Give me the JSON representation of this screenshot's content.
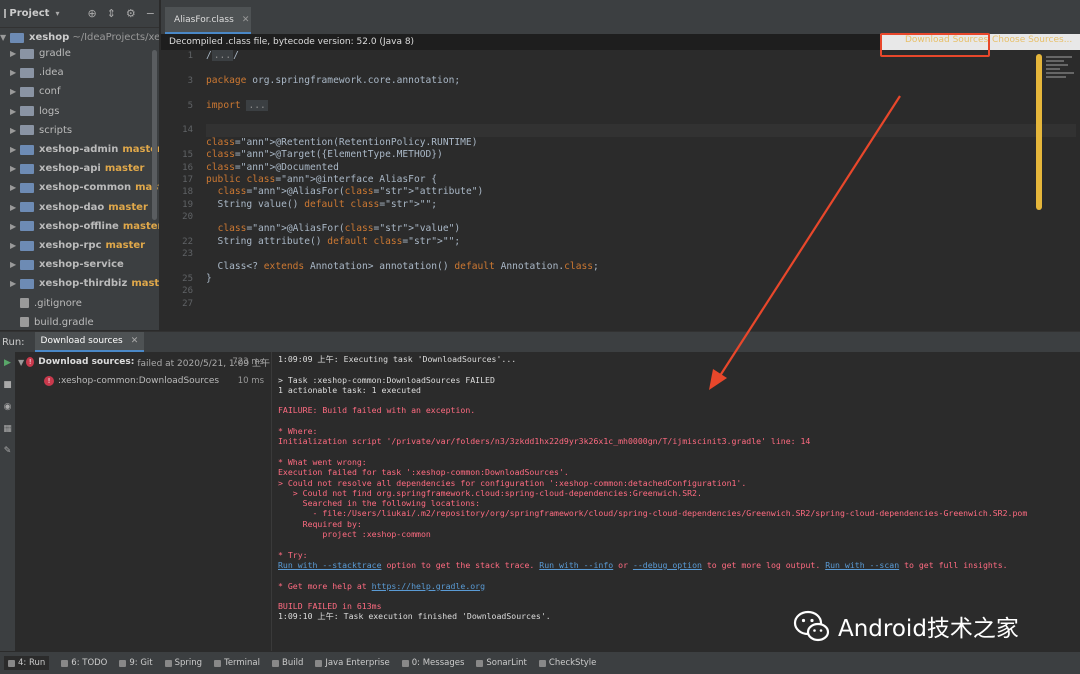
{
  "project": {
    "title": "Project",
    "root": "xeshop",
    "root_path": "~/IdeaProjects/xesho",
    "items": [
      {
        "label": "gradle",
        "branch": "",
        "type": "folder"
      },
      {
        "label": ".idea",
        "branch": "",
        "type": "folder"
      },
      {
        "label": "conf",
        "branch": "",
        "type": "folder"
      },
      {
        "label": "logs",
        "branch": "",
        "type": "folder"
      },
      {
        "label": "scripts",
        "branch": "",
        "type": "folder"
      },
      {
        "label": "xeshop-admin",
        "branch": "master",
        "type": "module"
      },
      {
        "label": "xeshop-api",
        "branch": "master",
        "type": "module"
      },
      {
        "label": "xeshop-common",
        "branch": "master",
        "type": "module"
      },
      {
        "label": "xeshop-dao",
        "branch": "master",
        "type": "module"
      },
      {
        "label": "xeshop-offline",
        "branch": "master",
        "type": "module"
      },
      {
        "label": "xeshop-rpc",
        "branch": "master",
        "type": "module"
      },
      {
        "label": "xeshop-service",
        "branch": "",
        "type": "module"
      },
      {
        "label": "xeshop-thirdbiz",
        "branch": "master",
        "type": "module"
      },
      {
        "label": ".gitignore",
        "branch": "",
        "type": "file"
      },
      {
        "label": "build.gradle",
        "branch": "",
        "type": "file"
      }
    ]
  },
  "editor": {
    "tab": "AliasFor.class",
    "notice": "Decompiled .class file, bytecode version: 52.0 (Java 8)",
    "download_sources": "Download Sources",
    "choose_sources": "Choose Sources...",
    "line_numbers": [
      "1",
      "",
      "3",
      "",
      "5",
      "",
      "14",
      "",
      "15",
      "16",
      "17",
      "18",
      "19",
      "20",
      "",
      "22",
      "23",
      "",
      "25",
      "26",
      "27"
    ],
    "code": [
      "/.../",
      "",
      "package org.springframework.core.annotation;",
      "",
      "import ...",
      "",
      "",
      "@Retention(RetentionPolicy.RUNTIME)",
      "@Target({ElementType.METHOD})",
      "@Documented",
      "public @interface AliasFor {",
      "  @AliasFor(\"attribute\")",
      "  String value() default \"\";",
      "",
      "  @AliasFor(\"value\")",
      "  String attribute() default \"\";",
      "",
      "  Class<? extends Annotation> annotation() default Annotation.class;",
      "}"
    ]
  },
  "run": {
    "label": "Run:",
    "tab": "Download sources",
    "tree": [
      {
        "label": "Download sources:",
        "detail": "failed at 2020/5/21, 1:09 上午",
        "duration": "723 ms"
      },
      {
        "label": ":xeshop-common:DownloadSources",
        "detail": "",
        "duration": "10 ms"
      }
    ],
    "console": [
      {
        "t": "1:09:09 上午: Executing task 'DownloadSources'...",
        "c": "normal"
      },
      {
        "t": "",
        "c": "blank"
      },
      {
        "t": "> Task :xeshop-common:DownloadSources FAILED",
        "c": "normal"
      },
      {
        "t": "1 actionable task: 1 executed",
        "c": "normal"
      },
      {
        "t": "",
        "c": "blank"
      },
      {
        "t": "FAILURE: Build failed with an exception.",
        "c": "red"
      },
      {
        "t": "",
        "c": "blank"
      },
      {
        "t": "* Where:",
        "c": "red"
      },
      {
        "t": "Initialization script '/private/var/folders/n3/3zkdd1hx22d9yr3k26x1c_mh0000gn/T/ijmiscinit3.gradle' line: 14",
        "c": "red"
      },
      {
        "t": "",
        "c": "blank"
      },
      {
        "t": "* What went wrong:",
        "c": "red"
      },
      {
        "t": "Execution failed for task ':xeshop-common:DownloadSources'.",
        "c": "red"
      },
      {
        "t": "> Could not resolve all dependencies for configuration ':xeshop-common:detachedConfiguration1'.",
        "c": "red"
      },
      {
        "t": "   > Could not find org.springframework.cloud:spring-cloud-dependencies:Greenwich.SR2.",
        "c": "red"
      },
      {
        "t": "     Searched in the following locations:",
        "c": "red"
      },
      {
        "t": "       - file:/Users/liukai/.m2/repository/org/springframework/cloud/spring-cloud-dependencies/Greenwich.SR2/spring-cloud-dependencies-Greenwich.SR2.pom",
        "c": "red"
      },
      {
        "t": "     Required by:",
        "c": "red"
      },
      {
        "t": "         project :xeshop-common",
        "c": "red"
      },
      {
        "t": "",
        "c": "blank"
      },
      {
        "t": "* Try:",
        "c": "red"
      },
      {
        "t": "",
        "c": "try"
      },
      {
        "t": "",
        "c": "blank"
      },
      {
        "t": "* Get more help at ",
        "c": "help"
      },
      {
        "t": "",
        "c": "blank"
      },
      {
        "t": "BUILD FAILED in 613ms",
        "c": "red"
      },
      {
        "t": "1:09:10 上午: Task execution finished 'DownloadSources'.",
        "c": "normal"
      }
    ],
    "try_parts": {
      "a": "Run with --stacktrace",
      "b": " option to get the stack trace. ",
      "c": "Run with --info",
      "d": " or ",
      "e": "--debug option",
      "f": " to get more log output. ",
      "g": "Run with --scan",
      "h": " to get full insights."
    },
    "help_link": "https://help.gradle.org"
  },
  "status_bar": [
    {
      "label": "4: Run",
      "active": true
    },
    {
      "label": "6: TODO",
      "active": false
    },
    {
      "label": "9: Git",
      "active": false
    },
    {
      "label": "Spring",
      "active": false
    },
    {
      "label": "Terminal",
      "active": false
    },
    {
      "label": "Build",
      "active": false
    },
    {
      "label": "Java Enterprise",
      "active": false
    },
    {
      "label": "0: Messages",
      "active": false
    },
    {
      "label": "SonarLint",
      "active": false
    },
    {
      "label": "CheckStyle",
      "active": false
    }
  ],
  "watermark": "Android技术之家",
  "colors": {
    "accent": "#4a88c7",
    "error": "#ff6b81",
    "annotation": "#e8472b",
    "branch": "#e0a84a"
  }
}
